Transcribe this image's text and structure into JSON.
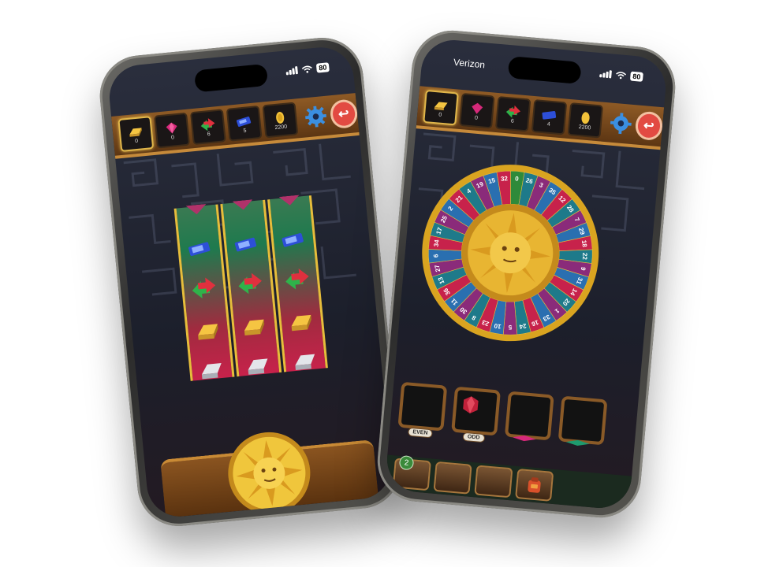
{
  "left_phone": {
    "status": {
      "battery": "80"
    },
    "resources": [
      {
        "name": "gold",
        "icon": "gold-bar-icon",
        "value": "0",
        "selected": true
      },
      {
        "name": "gem",
        "icon": "pink-gem-icon",
        "value": "0"
      },
      {
        "name": "arrows",
        "icon": "red-green-arrows-icon",
        "value": "6"
      },
      {
        "name": "ticket",
        "icon": "blue-ticket-icon",
        "value": "5"
      },
      {
        "name": "coin",
        "icon": "gold-coin-icon",
        "value": "2200"
      }
    ],
    "reel_symbols": [
      "blue-ticket-icon",
      "red-green-arrows-icon",
      "gold-bar-icon",
      "silver-bar-icon"
    ]
  },
  "right_phone": {
    "status": {
      "carrier": "Verizon",
      "battery": "80"
    },
    "resources": [
      {
        "name": "gold",
        "icon": "gold-bar-icon",
        "value": "0",
        "selected": true
      },
      {
        "name": "gem",
        "icon": "pink-gem-icon",
        "value": "0"
      },
      {
        "name": "arrows",
        "icon": "red-green-arrows-icon",
        "value": "6"
      },
      {
        "name": "ticket",
        "icon": "blue-ticket-icon",
        "value": "4"
      },
      {
        "name": "coin",
        "icon": "gold-coin-icon",
        "value": "2200"
      }
    ],
    "wheel_numbers": [
      "0",
      "26",
      "3",
      "35",
      "12",
      "28",
      "7",
      "29",
      "18",
      "22",
      "9",
      "31",
      "14",
      "20",
      "1",
      "33",
      "16",
      "24",
      "5",
      "10",
      "23",
      "8",
      "30",
      "11",
      "36",
      "13",
      "27",
      "6",
      "34",
      "17",
      "25",
      "2",
      "21",
      "4",
      "19",
      "15",
      "32"
    ],
    "bets": [
      {
        "label": "EVEN",
        "filled": false
      },
      {
        "label": "ODD",
        "filled": true
      },
      {
        "label": "",
        "filled": false
      },
      {
        "label": "",
        "filled": false
      }
    ],
    "bottom": {
      "badge": "2"
    }
  },
  "colors": {
    "gold": "#e6bd3b",
    "wood": "#8e5a25",
    "red": "#c7224b",
    "green": "#1e7a4e",
    "navy": "#1c1f2b"
  }
}
